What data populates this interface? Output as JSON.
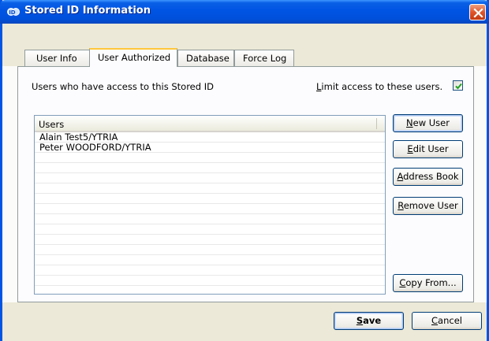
{
  "window": {
    "title": "Stored ID Information"
  },
  "tabs": [
    {
      "label": "User Info"
    },
    {
      "label": "User Authorized"
    },
    {
      "label": "Database"
    },
    {
      "label": "Force Log"
    }
  ],
  "active_tab": "User Authorized",
  "access_label": "Users who have access to this Stored ID",
  "limit_access": {
    "label_accel": "L",
    "label_rest": "imit access to these users.",
    "checked": true
  },
  "users_list": {
    "header": "Users",
    "rows": [
      "Alain Test5/YTRIA",
      "Peter WOODFORD/YTRIA"
    ]
  },
  "buttons": {
    "new_user": {
      "accel": "N",
      "rest": "ew User"
    },
    "edit_user": {
      "accel": "E",
      "rest": "dit User"
    },
    "address_book": {
      "accel": "A",
      "rest": "ddress Book"
    },
    "remove_user": {
      "accel": "R",
      "rest": "emove User"
    },
    "copy_from": {
      "accel": "C",
      "rest": "opy From..."
    },
    "save": {
      "accel": "S",
      "rest": "ave"
    },
    "cancel": {
      "accel": "C",
      "rest": "ancel"
    }
  },
  "icons": {
    "title": "stored-id-icon",
    "close": "close-icon",
    "check": "checkmark-icon"
  },
  "colors": {
    "titlebar": "#0054e3",
    "close": "#e0542a",
    "tab_highlight": "#ffc83c",
    "check": "#21a121"
  }
}
